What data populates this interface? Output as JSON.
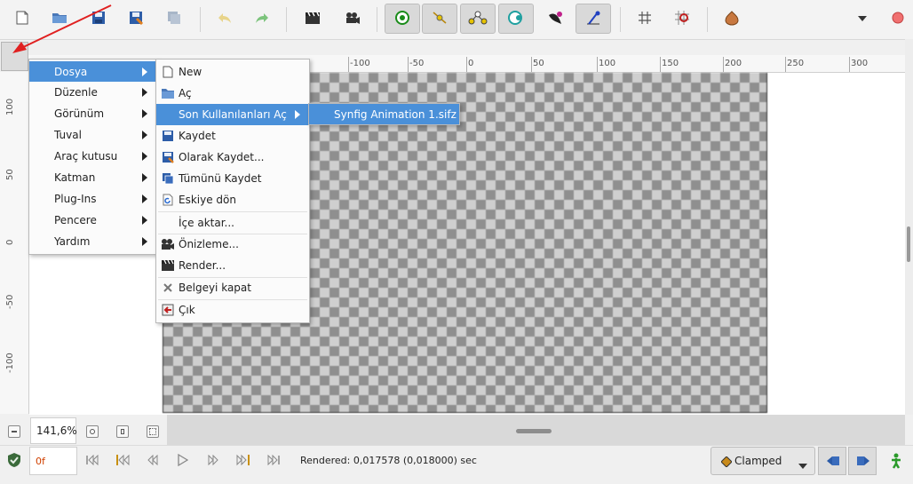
{
  "main_menu": {
    "items": [
      {
        "label": "Dosya"
      },
      {
        "label": "Düzenle"
      },
      {
        "label": "Görünüm"
      },
      {
        "label": "Tuval"
      },
      {
        "label": "Araç kutusu"
      },
      {
        "label": "Katman"
      },
      {
        "label": "Plug-Ins"
      },
      {
        "label": "Pencere"
      },
      {
        "label": "Yardım"
      }
    ]
  },
  "file_menu": {
    "items": [
      {
        "label": "New",
        "icon": "new-document-icon"
      },
      {
        "label": "Aç",
        "icon": "open-folder-icon"
      },
      {
        "label": "Son Kullanılanları Aç",
        "icon": ""
      },
      {
        "label": "Kaydet",
        "icon": "save-icon"
      },
      {
        "label": "Olarak Kaydet...",
        "icon": "save-as-icon"
      },
      {
        "label": "Tümünü Kaydet",
        "icon": "save-all-icon"
      },
      {
        "label": "Eskiye dön",
        "icon": "revert-icon"
      },
      {
        "label": "İçe aktar...",
        "icon": ""
      },
      {
        "label": "Önizleme...",
        "icon": "preview-camera-icon"
      },
      {
        "label": "Render...",
        "icon": "render-clapper-icon"
      },
      {
        "label": "Belgeyi kapat",
        "icon": "close-x-icon"
      },
      {
        "label": "Çık",
        "icon": "quit-icon"
      }
    ]
  },
  "recent_menu": {
    "items": [
      {
        "label": "Synfig Animation 1.sifz"
      }
    ]
  },
  "ruler": {
    "h_ticks": [
      "-100",
      "-50",
      "0",
      "50",
      "100",
      "150",
      "200",
      "250",
      "300"
    ],
    "v_ticks": [
      "100",
      "50",
      "0",
      "-50",
      "-100"
    ]
  },
  "zoom": {
    "value": "141,6%"
  },
  "time": {
    "frame": "0f"
  },
  "status": {
    "rendered": "Rendered: 0,017578 (0,018000) sec"
  },
  "interpolation": {
    "selected": "Clamped"
  },
  "colors": {
    "menu_highlight": "#4a90d9",
    "arrow_red": "#e02020",
    "frame_text": "#d04000"
  }
}
